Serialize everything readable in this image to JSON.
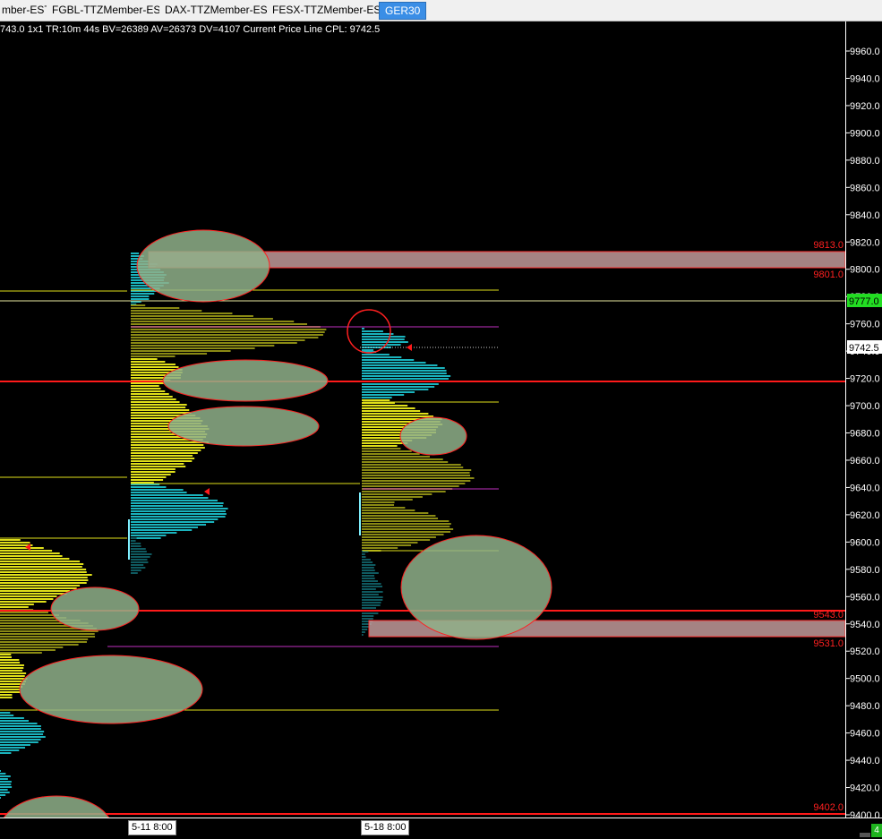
{
  "tabs": [
    {
      "label": "mber-EST",
      "active": false
    },
    {
      "label": "FGBL-TTZMember-EST",
      "active": false
    },
    {
      "label": "DAX-TTZMember-EST",
      "active": false
    },
    {
      "label": "FESX-TTZMember-EST",
      "active": false
    },
    {
      "label": "GER30",
      "active": true
    }
  ],
  "info_line": "743.0 1x1 TR:10m 44s BV=26389 AV=26373 DV=4107 Current Price Line  CPL: 9742.5",
  "price_axis": {
    "ticks": [
      "9960.0",
      "9940.0",
      "9920.0",
      "9900.0",
      "9880.0",
      "9860.0",
      "9840.0",
      "9820.0",
      "9800.0",
      "9780.0",
      "9760.0",
      "9740.0",
      "9720.0",
      "9700.0",
      "9680.0",
      "9660.0",
      "9640.0",
      "9620.0",
      "9600.0",
      "9580.0",
      "9560.0",
      "9540.0",
      "9520.0",
      "9500.0",
      "9480.0",
      "9460.0",
      "9440.0",
      "9420.0",
      "9400.0"
    ],
    "level_labels": [
      "9813.0",
      "9801.0",
      "9543.0",
      "9531.0",
      "9402.0"
    ],
    "marker_green": "9777.0",
    "marker_current": "9742.5"
  },
  "time_axis": {
    "labels": [
      "5-11  8:00",
      "5-18  8:00"
    ]
  },
  "status": {
    "badge": "4"
  },
  "colors": {
    "background": "#000000",
    "yellow": "#e0e01a",
    "olive": "#8a8a14",
    "cyan": "#1ab3bd",
    "teal_dark": "#0f5a60",
    "red_line": "#ff1a1a",
    "zone_fill": "#c9a0a0",
    "ellipse_fill": "#8fb08a",
    "magenta": "#c030c0",
    "green_marker": "#22dd22"
  }
}
